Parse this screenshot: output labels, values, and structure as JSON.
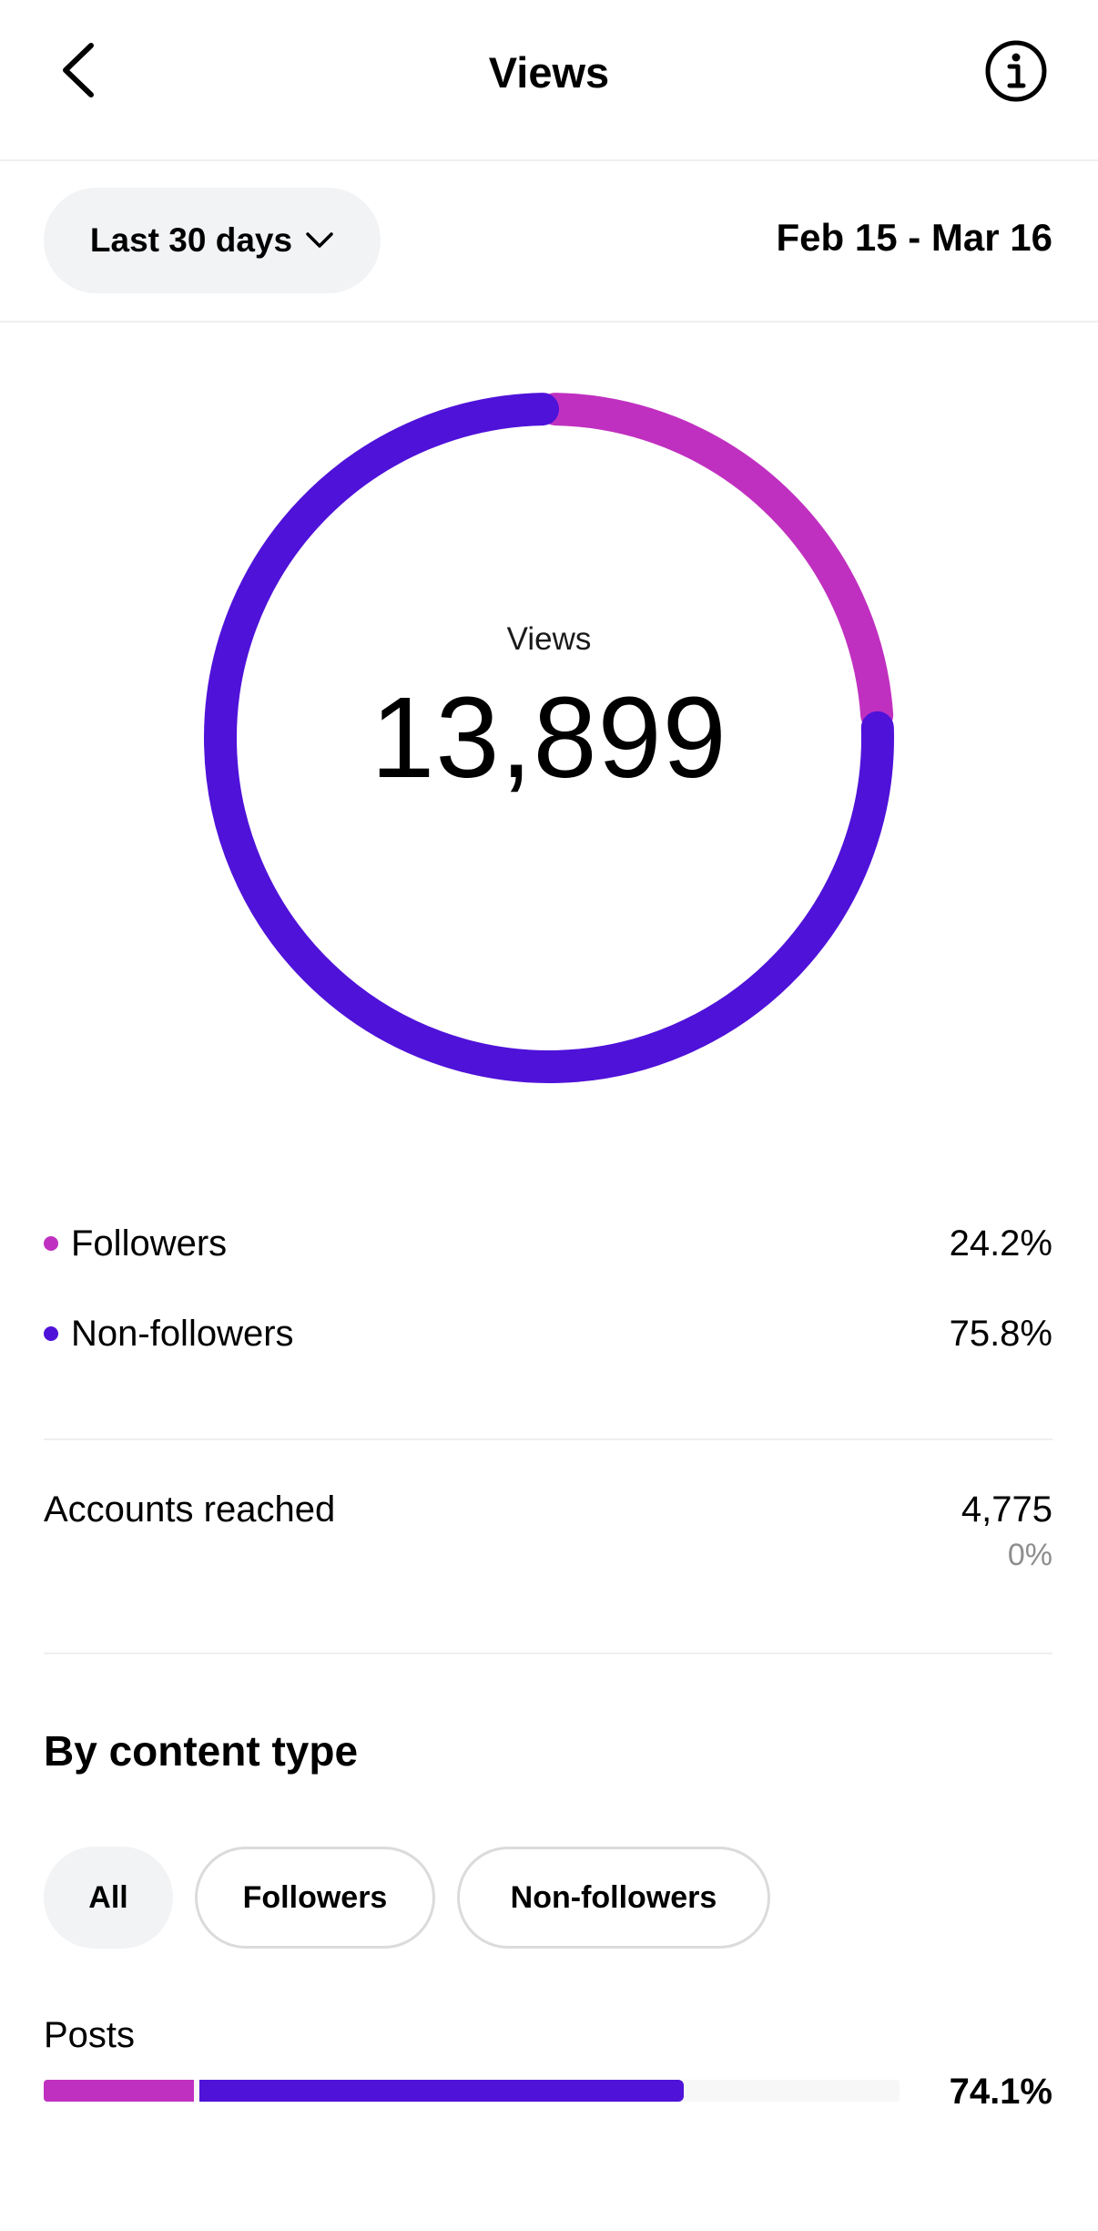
{
  "header": {
    "title": "Views",
    "back_icon": "chevron-left-icon",
    "info_icon": "info-circle-icon"
  },
  "filter": {
    "range_label": "Last 30 days",
    "dropdown_icon": "chevron-down-icon",
    "date_range": "Feb 15 - Mar 16"
  },
  "summary": {
    "label": "Views",
    "value": "13,899"
  },
  "colors": {
    "followers": "#c030c0",
    "non_followers": "#4f12d9",
    "track": "#f7f7f8"
  },
  "chart_data": {
    "type": "pie",
    "categories": [
      "Followers",
      "Non-followers"
    ],
    "values": [
      24.2,
      75.8
    ],
    "colors": [
      "#c030c0",
      "#4f12d9"
    ]
  },
  "legend": [
    {
      "label": "Followers",
      "value": "24.2%"
    },
    {
      "label": "Non-followers",
      "value": "75.8%"
    }
  ],
  "accounts": {
    "label": "Accounts reached",
    "value": "4,775",
    "change": "0%"
  },
  "content_type": {
    "title": "By content type",
    "chips": [
      "All",
      "Followers",
      "Non-followers"
    ],
    "active_chip": "All",
    "posts": {
      "label": "Posts",
      "percent_label": "74.1%",
      "followers_share": 0.175,
      "non_followers_share": 0.566
    }
  }
}
